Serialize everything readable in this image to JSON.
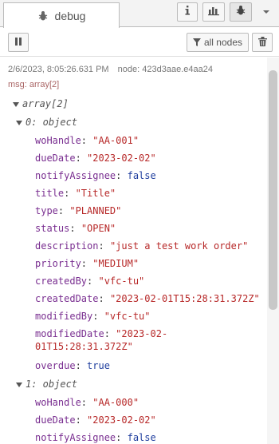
{
  "tab": {
    "label": "debug"
  },
  "toolbar": {
    "all_nodes_label": "all nodes"
  },
  "message": {
    "timestamp": "2/6/2023, 8:05:26.631 PM",
    "node": "node: 423d3aae.e4aa24",
    "topic": "msg: array[2]"
  },
  "tree": {
    "root_label": "array[2]",
    "item0_label": "0: object",
    "item1_label": "1: object",
    "items": [
      {
        "fields": [
          {
            "key": "woHandle",
            "value": "\"AA-001\"",
            "kind": "str"
          },
          {
            "key": "dueDate",
            "value": "\"2023-02-02\"",
            "kind": "str"
          },
          {
            "key": "notifyAssignee",
            "value": "false",
            "kind": "bool"
          },
          {
            "key": "title",
            "value": "\"Title\"",
            "kind": "str"
          },
          {
            "key": "type",
            "value": "\"PLANNED\"",
            "kind": "str"
          },
          {
            "key": "status",
            "value": "\"OPEN\"",
            "kind": "str"
          },
          {
            "key": "description",
            "value": "\"just a test work order\"",
            "kind": "str"
          },
          {
            "key": "priority",
            "value": "\"MEDIUM\"",
            "kind": "str"
          },
          {
            "key": "createdBy",
            "value": "\"vfc-tu\"",
            "kind": "str"
          },
          {
            "key": "createdDate",
            "value": "\"2023-02-01T15:28:31.372Z\"",
            "kind": "str"
          },
          {
            "key": "modifiedBy",
            "value": "\"vfc-tu\"",
            "kind": "str"
          },
          {
            "key": "modifiedDate",
            "value": "\"2023-02-01T15:28:31.372Z\"",
            "kind": "str"
          },
          {
            "key": "overdue",
            "value": "true",
            "kind": "bool"
          }
        ]
      },
      {
        "fields": [
          {
            "key": "woHandle",
            "value": "\"AA-000\"",
            "kind": "str"
          },
          {
            "key": "dueDate",
            "value": "\"2023-02-02\"",
            "kind": "str"
          },
          {
            "key": "notifyAssignee",
            "value": "false",
            "kind": "bool"
          }
        ]
      }
    ]
  }
}
